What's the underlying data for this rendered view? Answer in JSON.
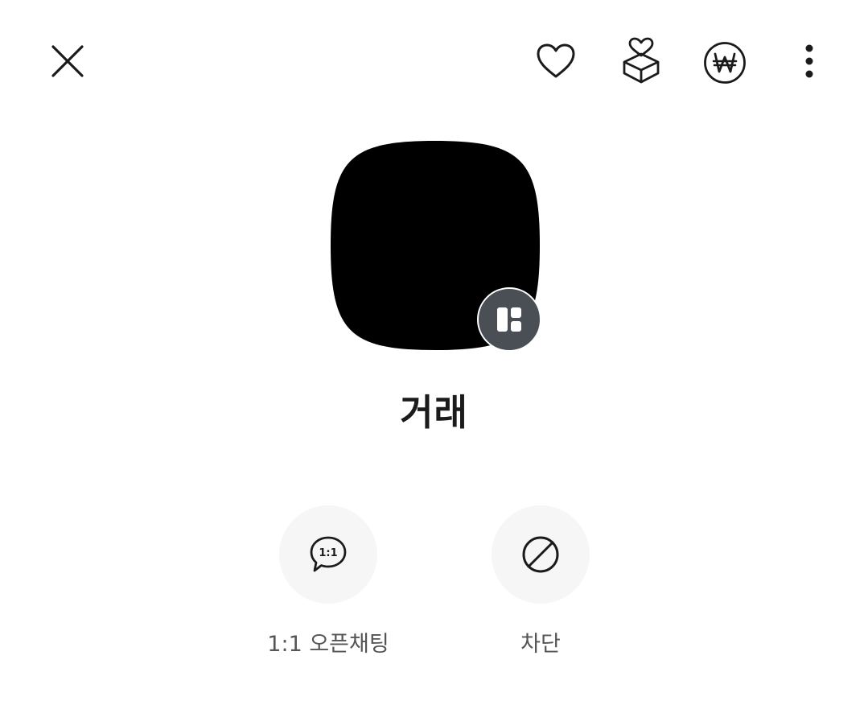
{
  "header": {
    "icons": {
      "close": "close-icon",
      "like": "heart-icon",
      "gift": "gift-box-heart-icon",
      "payment": "won-currency-icon",
      "more": "more-vertical-icon"
    }
  },
  "profile": {
    "name": "거래",
    "image_color": "#000000",
    "badge_color": "#4a4f56",
    "badge_icon": "board-layout-icon"
  },
  "actions": [
    {
      "label": "1:1 오픈채팅",
      "icon": "chat-bubble-1to1-icon",
      "icon_text": "1:1"
    },
    {
      "label": "차단",
      "icon": "block-icon"
    }
  ],
  "colors": {
    "background": "#ffffff",
    "text_primary": "#1b1b1b",
    "text_secondary": "#555555",
    "action_bg": "#f6f6f6"
  }
}
